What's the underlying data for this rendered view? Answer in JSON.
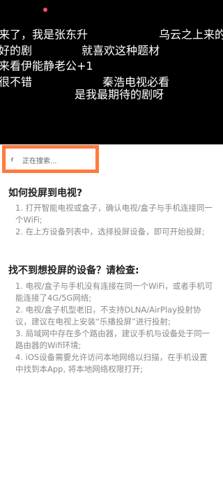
{
  "video": {
    "danmaku": [
      "来了，我是张东升",
      "乌云之上来的",
      "好的剧",
      "就喜欢这种题材",
      "来看伊能静老公+1",
      "很不错",
      "秦浩电视必看",
      "是我最期待的剧呀"
    ]
  },
  "search": {
    "status": "正在搜索..."
  },
  "howto": {
    "title": "如何投屏到电视?",
    "items": [
      "1. 打开智能电视或盒子，确认电视/盒子与手机连接同一个WiFi;",
      "2. 在上方设备列表中，选择投屏设备，即可开始投屏;"
    ]
  },
  "check": {
    "title": "找不到想投屏的设备？请检查:",
    "items": [
      "1. 电视/盒子与手机没有连接在同一个WiFi，或者手机可能连接了4G/5G网络;",
      "2. 电视/盒子机型老旧，不支持DLNA/AirPlay投射协议，建议在电视上安装“乐播投屏”进行投射;",
      "3. 局域网中存在多个路由器，建议手机与设备处于同一路由器的Wifi环境;",
      "4. iOS设备需要允许访问本地网络以扫描，在手机设置中找到本App, 将本地网络权限打开;"
    ]
  }
}
